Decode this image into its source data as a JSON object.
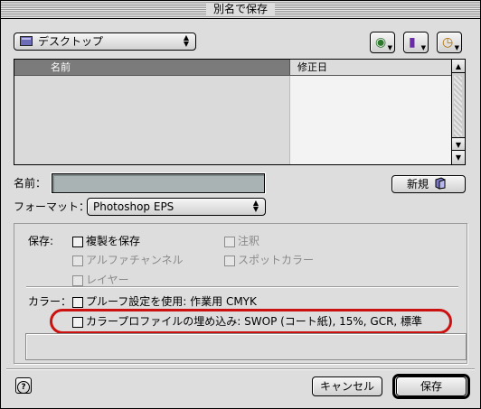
{
  "window": {
    "title": "別名で保存"
  },
  "location": {
    "selected": "デスクトップ"
  },
  "toolbar": {
    "icons": [
      "shortcuts-icon",
      "favorites-icon",
      "recent-icon"
    ]
  },
  "file_list": {
    "columns": [
      "名前",
      "修正日"
    ],
    "rows": []
  },
  "name_row": {
    "label": "名前：",
    "value": "",
    "new_button": "新規"
  },
  "format_row": {
    "label": "フォーマット：",
    "selected": "Photoshop EPS"
  },
  "save_options": {
    "label": "保存:",
    "duplicate": "複製を保存",
    "annotation": "注釈",
    "alpha": "アルファチャンネル",
    "spot": "スポットカラー",
    "layers": "レイヤー"
  },
  "color_options": {
    "label": "カラー：",
    "proof": "プルーフ設定を使用: 作業用 CMYK",
    "embed_profile": "カラープロファイルの埋め込み: SWOP (コート紙), 15%, GCR, 標準"
  },
  "buttons": {
    "cancel": "キャンセル",
    "save": "保存"
  },
  "colors": {
    "highlight": "#cc1111",
    "window_bg": "#dddddd",
    "name_field_bg": "#a9b3b3"
  }
}
